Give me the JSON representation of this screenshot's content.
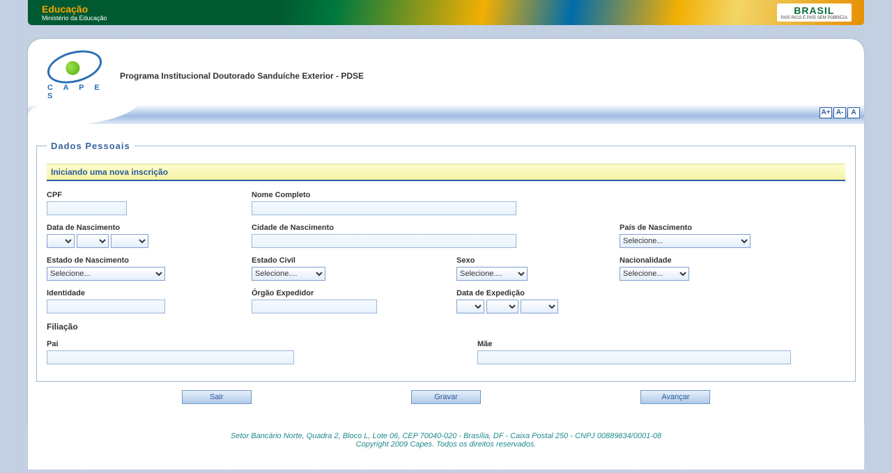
{
  "topbar": {
    "edu_title": "Educação",
    "edu_sub": "Ministério da Educação",
    "brasil": "BRASIL",
    "brasil_sub": "PAÍS RICO É PAÍS SEM POBREZA"
  },
  "header": {
    "capes": "C A P E S",
    "app_title": "Programa Institucional Doutorado Sanduíche Exterior - PDSE",
    "font_plus": "A+",
    "font_minus": "A-",
    "font_reset": "A"
  },
  "form": {
    "legend": "Dados Pessoais",
    "banner": "Iniciando uma nova inscrição",
    "cpf_label": "CPF",
    "nome_label": "Nome Completo",
    "data_nasc_label": "Data de Nascimento",
    "cidade_nasc_label": "Cidade de Nascimento",
    "pais_nasc_label": "País de Nascimento",
    "pais_nasc_selected": "Selecione...",
    "estado_nasc_label": "Estado de Nascimento",
    "estado_nasc_selected": "Selecione...",
    "estado_civil_label": "Estado Civil",
    "estado_civil_selected": "Selecione....",
    "sexo_label": "Sexo",
    "sexo_selected": "Selecione....",
    "nacionalidade_label": "Nacionalidade",
    "nacionalidade_selected": "Selecione...",
    "identidade_label": "Identidade",
    "orgao_label": "Órgão Expedidor",
    "data_exp_label": "Data de Expedição",
    "filiacao_label": "Filiação",
    "pai_label": "Pai",
    "mae_label": "Mãe"
  },
  "buttons": {
    "sair": "Sair",
    "gravar": "Gravar",
    "avancar": "Avançar"
  },
  "footer": {
    "line1": "Setor Bancário Norte, Quadra 2, Bloco L, Lote 06, CEP 70040-020 - Brasília, DF - Caixa Postal 250 - CNPJ 00889834/0001-08",
    "line2": "Copyright 2009 Capes. Todos os direitos reservados."
  }
}
